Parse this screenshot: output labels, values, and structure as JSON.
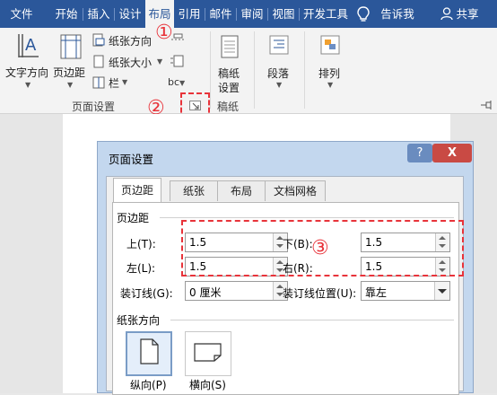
{
  "menubar": {
    "tabs": [
      "文件",
      "开始",
      "插入",
      "设计",
      "布局",
      "引用",
      "邮件",
      "审阅",
      "视图",
      "开发工具"
    ],
    "active_tab": "布局",
    "tell_me": "告诉我",
    "share": "共享",
    "bg_color": "#2b579a"
  },
  "ribbon": {
    "text_direction": "文字方向",
    "margins": "页边距",
    "orientation": "纸张方向",
    "size": "纸张大小",
    "columns": "栏",
    "breaks_glyph": "bc",
    "page_setup_group": "页面设置",
    "draft_paper": [
      "稿纸",
      "设置"
    ],
    "draft_group": "稿纸",
    "paragraph": "段落",
    "arrange": "排列"
  },
  "annotations": {
    "marker1": "①",
    "marker2": "②",
    "marker3": "③",
    "color": "#e8333a"
  },
  "dialog": {
    "title": "页面设置",
    "help": "?",
    "close": "X",
    "tabs": [
      "页边距",
      "纸张",
      "布局",
      "文档网格"
    ],
    "active_tab": "页边距",
    "margins_group": "页边距",
    "top_label": "上(T):",
    "top_value": "1.5",
    "bottom_label": "下(B):",
    "bottom_value": "1.5",
    "left_label": "左(L):",
    "left_value": "1.5",
    "right_label": "右(R):",
    "right_value": "1.5",
    "gutter_label": "装订线(G):",
    "gutter_value": "0 厘米",
    "gutter_pos_label": "装订线位置(U):",
    "gutter_pos_value": "靠左",
    "orientation_group": "纸张方向",
    "portrait": "纵向(P)",
    "landscape": "横向(S)"
  }
}
